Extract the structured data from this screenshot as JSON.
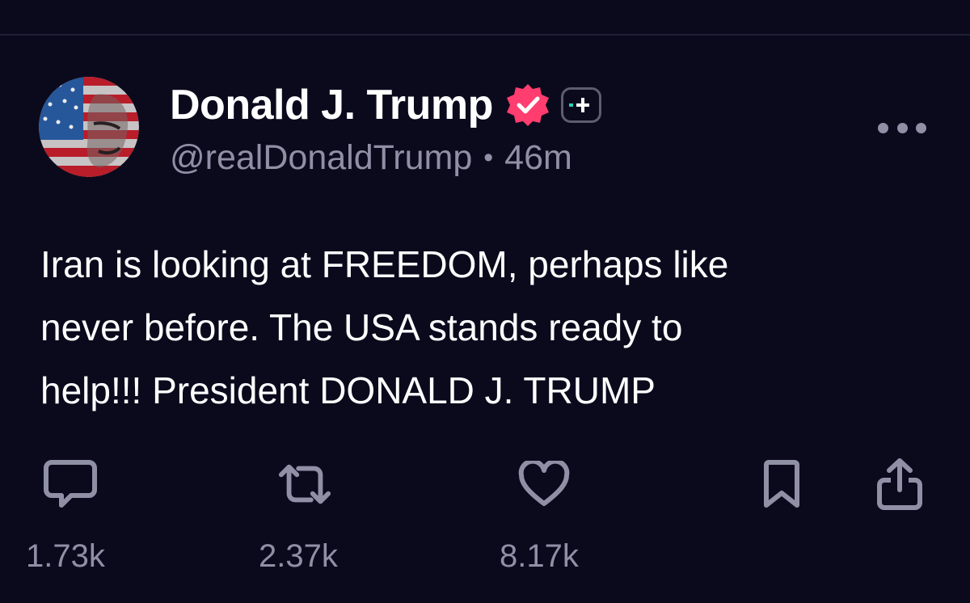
{
  "author": {
    "display_name": "Donald J. Trump",
    "handle": "@realDonaldTrump",
    "time_ago": "46m",
    "separator": "•",
    "verified_badge_color": "#ff3d6e"
  },
  "post": {
    "text": "Iran is looking at FREEDOM, perhaps like\nnever before. The USA stands ready to\nhelp!!! President DONALD J. TRUMP"
  },
  "actions": {
    "replies": {
      "icon": "reply-icon",
      "count": "1.73k"
    },
    "reposts": {
      "icon": "repost-icon",
      "count": "2.37k"
    },
    "likes": {
      "icon": "heart-icon",
      "count": "8.17k"
    },
    "bookmark": {
      "icon": "bookmark-icon"
    },
    "share": {
      "icon": "share-icon"
    }
  },
  "colors": {
    "background": "#0b0a1d",
    "text_primary": "#ffffff",
    "text_secondary": "#8f90a6",
    "icon": "#8f90a6"
  }
}
